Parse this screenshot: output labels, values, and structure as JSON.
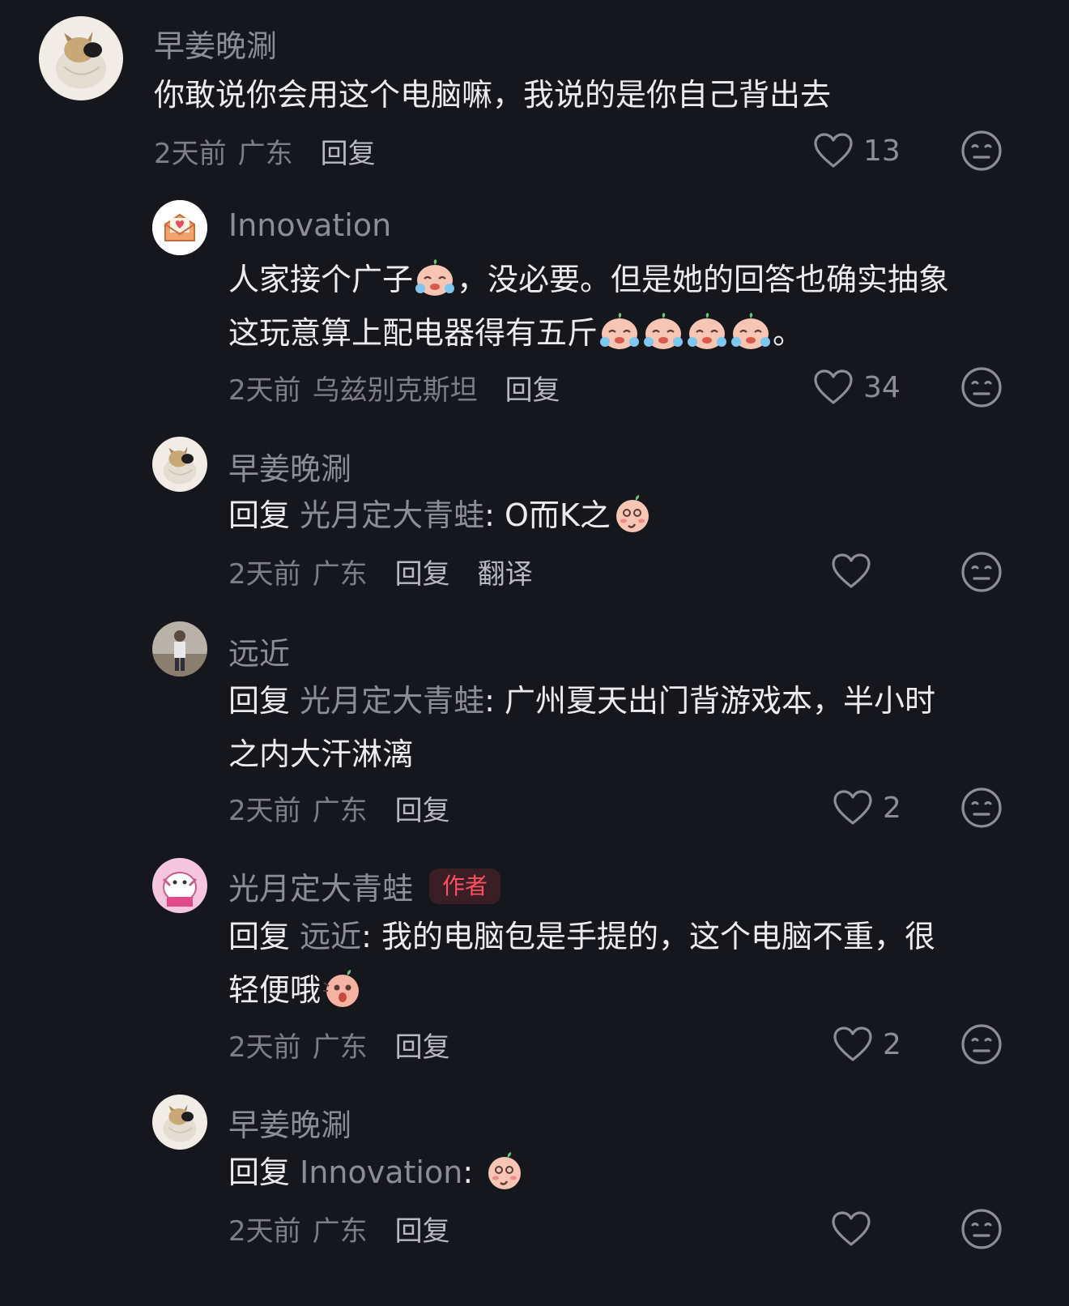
{
  "comments": [
    {
      "username": "早姜晚涮",
      "text_lines": [
        "你敢说你会用这个电脑嘛，我说的是你自己背出去"
      ],
      "time": "2天前",
      "location": "广东",
      "reply_label": "回复",
      "likes": "13",
      "avatar": "dog-avatar"
    },
    {
      "username": "Innovation",
      "text_line1_a": "人家接个广子",
      "text_line1_b": "，没必要。但是她的回答也确实抽象",
      "text_line2_a": "这玩意算上配电器得有五斤",
      "text_line2_b": "。",
      "time": "2天前",
      "location": "乌兹别克斯坦",
      "reply_label": "回复",
      "likes": "34",
      "avatar": "mail-heart-avatar"
    },
    {
      "username": "早姜晚涮",
      "reply_prefix": "回复",
      "reply_target": "光月定大青蛙",
      "reply_text": ": O而K之",
      "time": "2天前",
      "location": "广东",
      "reply_label": "回复",
      "translate_label": "翻译",
      "likes": "",
      "avatar": "dog-avatar"
    },
    {
      "username": "远近",
      "reply_prefix": "回复",
      "reply_target": "光月定大青蛙",
      "reply_text": ": 广州夏天出门背游戏本，半小时",
      "text_line2": "之内大汗淋漓",
      "time": "2天前",
      "location": "广东",
      "reply_label": "回复",
      "likes": "2",
      "avatar": "person-avatar"
    },
    {
      "username": "光月定大青蛙",
      "badge": "作者",
      "reply_prefix": "回复",
      "reply_target": "远近",
      "reply_text": ": 我的电脑包是手提的，这个电脑不重，很",
      "text_line2": "轻便哦",
      "time": "2天前",
      "location": "广东",
      "reply_label": "回复",
      "likes": "2",
      "avatar": "cartoon-avatar"
    },
    {
      "username": "早姜晚涮",
      "reply_prefix": "回复",
      "reply_target": "Innovation",
      "reply_text": ":",
      "time": "2天前",
      "location": "广东",
      "reply_label": "回复",
      "likes": "",
      "avatar": "dog-avatar"
    }
  ],
  "colors": {
    "background": "#16161d",
    "text": "#ececf0",
    "muted": "#8d8d96",
    "badge": "#ff4f5e"
  }
}
